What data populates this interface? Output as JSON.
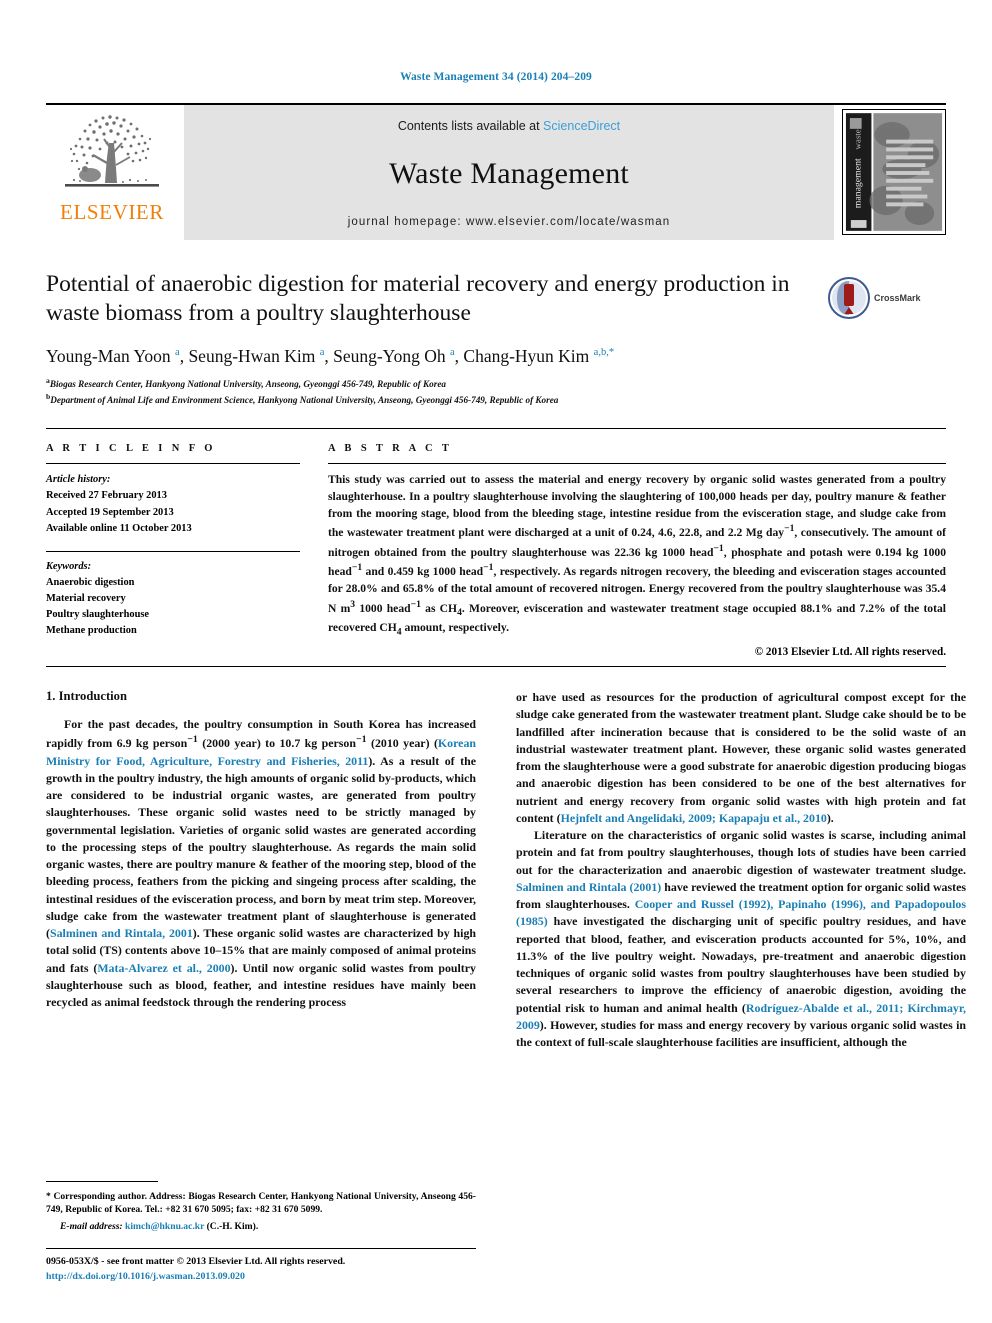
{
  "running_head": "Waste Management 34 (2014) 204–209",
  "masthead": {
    "publisher_name": "ELSEVIER",
    "contents_prefix": "Contents lists available at ",
    "sciencedirect": "ScienceDirect",
    "journal_name": "Waste Management",
    "homepage": "journal homepage: www.elsevier.com/locate/wasman",
    "cover_journal_text": "waste management"
  },
  "title": "Potential of anaerobic digestion for material recovery and energy production in waste biomass from a poultry slaughterhouse",
  "crossmark_label": "CrossMark",
  "authors_html": "Young-Man Yoon <sup>a</sup>, Seung-Hwan Kim <sup>a</sup>, Seung-Yong Oh <sup>a</sup>, Chang-Hyun Kim <sup>a,b,</sup><sup>*</sup>",
  "affiliations": [
    "Biogas Research Center, Hankyong National University, Anseong, Gyeonggi 456-749, Republic of Korea",
    "Department of Animal Life and Environment Science, Hankyong National University, Anseong, Gyeonggi 456-749, Republic of Korea"
  ],
  "affiliation_marks": [
    "a",
    "b"
  ],
  "article_info": {
    "label": "A R T I C L E    I N F O",
    "history_head": "Article history:",
    "history": [
      "Received 27 February 2013",
      "Accepted 19 September 2013",
      "Available online 11 October 2013"
    ],
    "keywords_head": "Keywords:",
    "keywords": [
      "Anaerobic digestion",
      "Material recovery",
      "Poultry slaughterhouse",
      "Methane production"
    ]
  },
  "abstract": {
    "label": "A B S T R A C T",
    "text_html": "This study was carried out to assess the material and energy recovery by organic solid wastes generated from a poultry slaughterhouse. In a poultry slaughterhouse involving the slaughtering of 100,000 heads per day, poultry manure &amp; feather from the mooring stage, blood from the bleeding stage, intestine residue from the evisceration stage, and sludge cake from the wastewater treatment plant were discharged at a unit of 0.24, 4.6, 22.8, and 2.2 Mg day<sup>−1</sup>, consecutively. The amount of nitrogen obtained from the poultry slaughterhouse was 22.36 kg 1000 head<sup>−1</sup>, phosphate and potash were 0.194 kg 1000 head<sup>−1</sup> and 0.459 kg 1000 head<sup>−1</sup>, respectively. As regards nitrogen recovery, the bleeding and evisceration stages accounted for 28.0% and 65.8% of the total amount of recovered nitrogen. Energy recovered from the poultry slaughterhouse was 35.4 N m<sup>3</sup> 1000 head<sup>−1</sup> as CH<sub>4</sub>. Moreover, evisceration and wastewater treatment stage occupied 88.1% and 7.2% of the total recovered CH<sub>4</sub> amount, respectively.",
    "copyright": "© 2013 Elsevier Ltd. All rights reserved."
  },
  "body": {
    "section_heading": "1. Introduction",
    "left_paragraphs_html": [
      "For the past decades, the poultry consumption in South Korea has increased rapidly from 6.9 kg person<sup>−1</sup> (2000 year) to 10.7 kg person<sup>−1</sup> (2010 year) (<span class=\"ref\">Korean Ministry for Food, Agriculture, Forestry and Fisheries, 2011</span>). As a result of the growth in the poultry industry, the high amounts of organic solid by-products, which are considered to be industrial organic wastes, are generated from poultry slaughterhouses. These organic solid wastes need to be strictly managed by governmental legislation. Varieties of organic solid wastes are generated according to the processing steps of the poultry slaughterhouse. As regards the main solid organic wastes, there are poultry manure &amp; feather of the mooring step, blood of the bleeding process, feathers from the picking and singeing process after scalding, the intestinal residues of the evisceration process, and born by meat trim step. Moreover, sludge cake from the wastewater treatment plant of slaughterhouse is generated (<span class=\"ref\">Salminen and Rintala, 2001</span>). These organic solid wastes are characterized by high total solid (TS) contents above 10–15% that are mainly composed of animal proteins and fats (<span class=\"ref\">Mata-Alvarez et al., 2000</span>). Until now organic solid wastes from poultry slaughterhouse such as blood, feather, and intestine residues have mainly been recycled as animal feedstock through the rendering process"
    ],
    "right_paragraphs_html": [
      "or have used as resources for the production of agricultural compost except for the sludge cake generated from the wastewater treatment plant. Sludge cake should be to be landfilled after incineration because that is considered to be the solid waste of an industrial wastewater treatment plant. However, these organic solid wastes generated from the slaughterhouse were a good substrate for anaerobic digestion producing biogas and anaerobic digestion has been considered to be one of the best alternatives for nutrient and energy recovery from organic solid wastes with high protein and fat content (<span class=\"ref\">Hejnfelt and Angelidaki, 2009; Kapараju et al., 2010</span>).",
      "Literature on the characteristics of organic solid wastes is scarse, including animal protein and fat from poultry slaughterhouses, though lots of studies have been carried out for the characterization and anaerobic digestion of wastewater treatment sludge. <span class=\"ref\">Salminen and Rintala (2001)</span> have reviewed the treatment option for organic solid wastes from slaughterhouses. <span class=\"ref\">Cooper and Russel (1992), Papinaho (1996), and Papadopoulos (1985)</span> have investigated the discharging unit of specific poultry residues, and have reported that blood, feather, and evisceration products accounted for 5%, 10%, and 11.3% of the live poultry weight. Nowadays, pre-treatment and anaerobic digestion techniques of organic solid wastes from poultry slaughterhouses have been studied by several researchers to improve the efficiency of anaerobic digestion, avoiding the potential risk to human and animal health (<span class=\"ref\">Rodríguez-Abalde et al., 2011; Kirchmayr, 2009</span>). However, studies for mass and energy recovery by various organic solid wastes in the context of full-scale slaughterhouse facilities are insufficient, although the"
    ]
  },
  "footnotes": {
    "corresponding_html": "* Corresponding author. Address: Biogas Research Center, Hankyong National University, Anseong 456-749, Republic of Korea. Tel.: +82 31 670 5095; fax: +82 31 670 5099.",
    "email_label": "E-mail address:",
    "email": "kimch@hknu.ac.kr",
    "email_suffix": "(C.-H. Kim).",
    "issn_line": "0956-053X/$ - see front matter © 2013 Elsevier Ltd. All rights reserved.",
    "doi": "http://dx.doi.org/10.1016/j.wasman.2013.09.020"
  },
  "colors": {
    "link": "#1a7fb5",
    "sciencedirect": "#3c9fd6",
    "elsevier_orange": "#f07f09",
    "band_gray": "#e3e3e3"
  }
}
